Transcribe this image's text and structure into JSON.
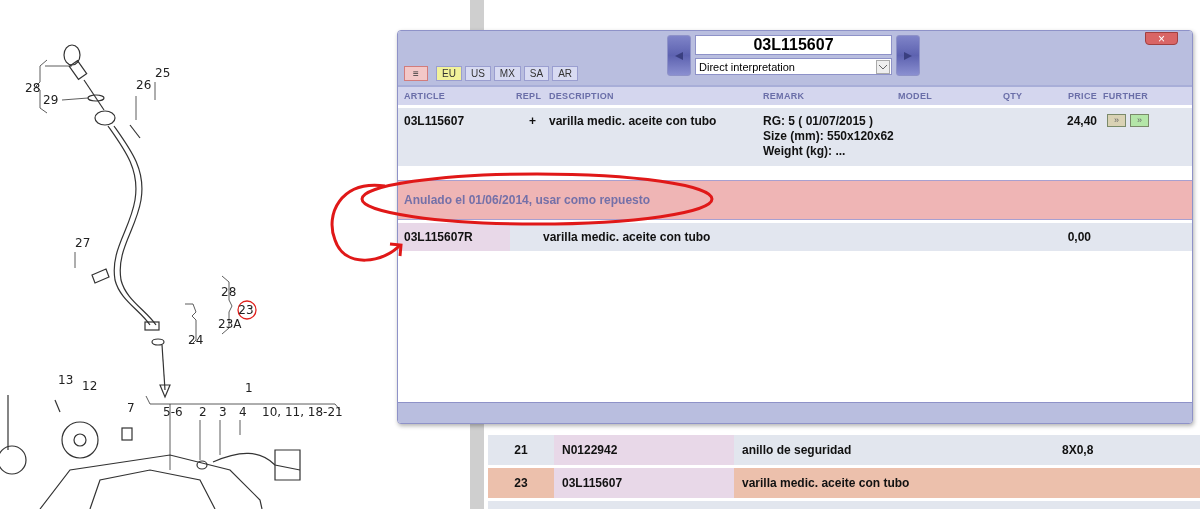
{
  "diagram": {
    "callouts": [
      {
        "label": "28",
        "circled": false
      },
      {
        "label": "29",
        "circled": false
      },
      {
        "label": "26",
        "circled": false
      },
      {
        "label": "25",
        "circled": false
      },
      {
        "label": "27",
        "circled": false
      },
      {
        "label": "28",
        "circled": false
      },
      {
        "label": "23",
        "circled": true
      },
      {
        "label": "23A",
        "circled": false
      },
      {
        "label": "24",
        "circled": false
      },
      {
        "label": "13",
        "circled": false
      },
      {
        "label": "12",
        "circled": false
      },
      {
        "label": "7",
        "circled": false
      },
      {
        "label": "1",
        "circled": false
      },
      {
        "label": "5-6",
        "circled": false
      },
      {
        "label": "2",
        "circled": false
      },
      {
        "label": "3",
        "circled": false
      },
      {
        "label": "4",
        "circled": false
      },
      {
        "label": "10, 11, 18-21",
        "circled": false
      }
    ]
  },
  "background_table": {
    "rows": [
      {
        "number": "21",
        "article": "N0122942",
        "description": "anillo de seguridad",
        "size": "8X0,8",
        "highlighted": false
      },
      {
        "number": "23",
        "article": "03L115607",
        "description": "varilla medic. aceite con tubo",
        "size": "",
        "highlighted": true
      }
    ]
  },
  "dialog": {
    "regions": [
      {
        "label": "≡",
        "kind": "menu",
        "selected": false
      },
      {
        "label": "EU",
        "kind": "region",
        "selected": true
      },
      {
        "label": "US",
        "kind": "region",
        "selected": false
      },
      {
        "label": "MX",
        "kind": "region",
        "selected": false
      },
      {
        "label": "SA",
        "kind": "region",
        "selected": false
      },
      {
        "label": "AR",
        "kind": "region",
        "selected": false
      }
    ],
    "article_input": {
      "value": "03L115607"
    },
    "interpretation_select": {
      "value": "Direct interpretation"
    },
    "close_button": {
      "label": "×"
    },
    "columns": [
      "ARTICLE",
      "REPL",
      "DESCRIPTION",
      "REMARK",
      "MODEL",
      "QTY",
      "PRICE",
      "FURTHER"
    ],
    "parts": [
      {
        "article": "03L115607",
        "repl": "+",
        "description": "varilla medic. aceite con tubo",
        "remark": [
          "RG: 5 ( 01/07/2015 )",
          "Size (mm): 550x120x62",
          "Weight (kg): ..."
        ],
        "price": "24,40",
        "further_buttons": [
          {
            "label": "»",
            "color": "#d9d2b4"
          },
          {
            "label": "»",
            "color": "#b4e6a8"
          }
        ]
      }
    ],
    "notice": "Anulado el 01/06/2014, usar como repuesto",
    "replacements": [
      {
        "article": "03L115607R",
        "description": "varilla medic. aceite con tubo",
        "price": "0,00"
      }
    ]
  }
}
